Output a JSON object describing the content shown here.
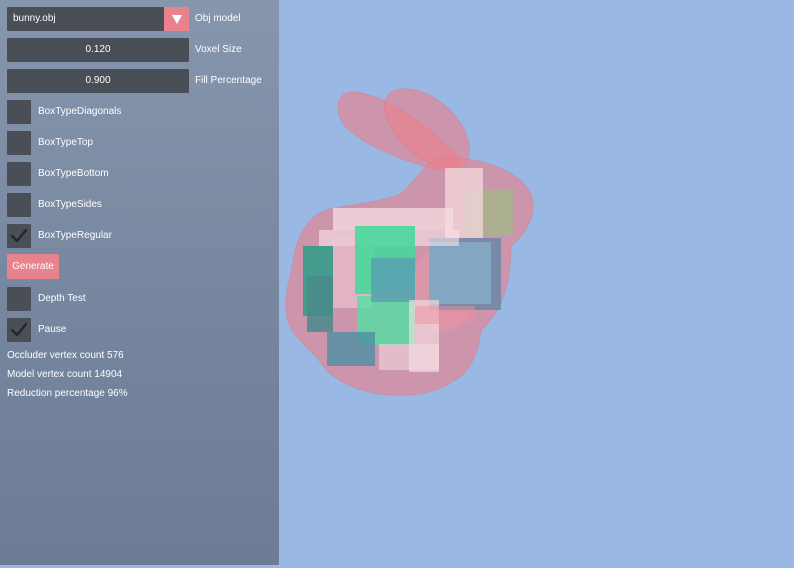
{
  "panel": {
    "model": {
      "value": "bunny.obj",
      "label": "Obj model"
    },
    "voxel_size": {
      "value": "0.120",
      "label": "Voxel Size"
    },
    "fill_percentage": {
      "value": "0.900",
      "label": "Fill Percentage"
    },
    "checkboxes": [
      {
        "label": "BoxTypeDiagonals",
        "checked": false
      },
      {
        "label": "BoxTypeTop",
        "checked": false
      },
      {
        "label": "BoxTypeBottom",
        "checked": false
      },
      {
        "label": "BoxTypeSides",
        "checked": false
      },
      {
        "label": "BoxTypeRegular",
        "checked": true
      }
    ],
    "generate_label": "Generate",
    "depth_test": {
      "label": "Depth Test",
      "checked": false
    },
    "pause": {
      "label": "Pause",
      "checked": true
    },
    "stats": {
      "occluder": "Occluder vertex count 576",
      "model": "Model vertex count 14904",
      "reduction": "Reduction percentage 96%"
    }
  },
  "colors": {
    "accent": "#e8828c",
    "viewport_bg": "#99b8e3",
    "control_bg": "#4a4e56"
  }
}
